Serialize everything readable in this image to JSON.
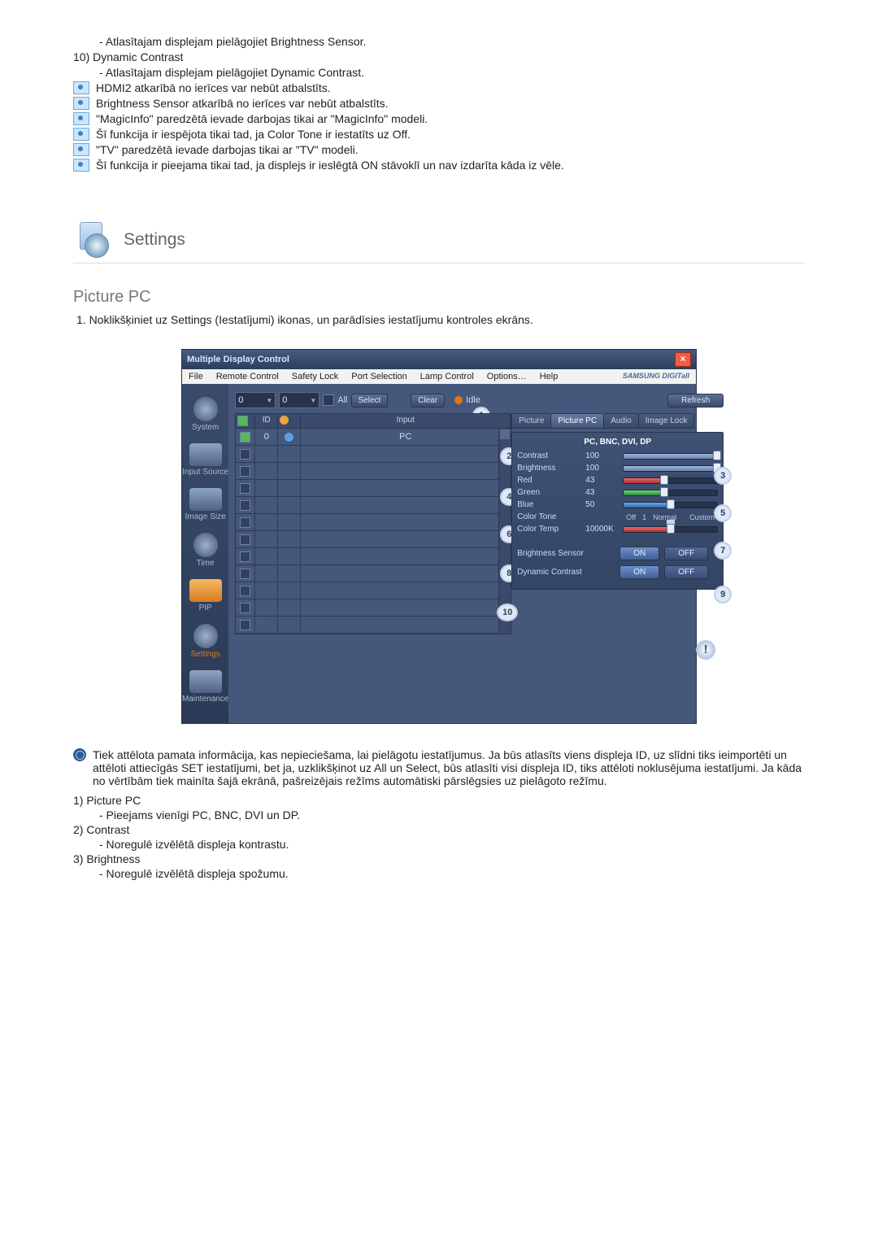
{
  "intro": {
    "line1": "- Atlasītajam displejam pielāgojiet Brightness Sensor.",
    "line2_head": "10) Dynamic Contrast",
    "line2_body": "- Atlasītajam displejam pielāgojiet Dynamic Contrast."
  },
  "notes": [
    "HDMI2 atkarībā no ierīces var nebūt atbalstīts.",
    "Brightness Sensor atkarībā no ierīces var nebūt atbalstīts.",
    "\"MagicInfo\" paredzētā ievade darbojas tikai ar \"MagicInfo\" modeli.",
    "Šī funkcija ir iespējota tikai tad, ja Color Tone ir iestatīts uz Off.",
    "\"TV\" paredzētā ievade darbojas tikai ar \"TV\" modeli.",
    "Šī funkcija ir pieejama tikai tad, ja displejs ir ieslēgtā ON stāvoklī un nav izdarīta kāda iz vēle."
  ],
  "section": {
    "title": "Settings",
    "subtitle": "Picture PC",
    "step1": "1. Noklikšķiniet uz Settings (Iestatījumi) ikonas, un parādīsies iestatījumu kontroles ekrāns."
  },
  "mdc": {
    "title": "Multiple Display Control",
    "close": "×",
    "menu": [
      "File",
      "Remote Control",
      "Safety Lock",
      "Port Selection",
      "Lamp Control",
      "Options…",
      "Help"
    ],
    "brand": "SAMSUNG DIGITall",
    "sidebar": [
      {
        "label": "System"
      },
      {
        "label": "Input Source"
      },
      {
        "label": "Image Size"
      },
      {
        "label": "Time"
      },
      {
        "label": "PIP"
      },
      {
        "label": "Settings",
        "active": true
      },
      {
        "label": "Maintenance"
      }
    ],
    "controls": {
      "num1": "0",
      "num2": "0",
      "all": "All",
      "select": "Select",
      "clear": "Clear",
      "idle": "Idle",
      "refresh": "Refresh"
    },
    "table": {
      "headers": {
        "id": "ID",
        "input": "Input"
      },
      "row0_input": "PC"
    },
    "tabs": [
      "Picture",
      "Picture PC",
      "Audio",
      "Image Lock"
    ],
    "panel": {
      "title": "PC, BNC, DVI, DP",
      "contrast": {
        "label": "Contrast",
        "value": "100"
      },
      "brightness": {
        "label": "Brightness",
        "value": "100"
      },
      "red": {
        "label": "Red",
        "value": "43"
      },
      "green": {
        "label": "Green",
        "value": "43"
      },
      "blue": {
        "label": "Blue",
        "value": "50"
      },
      "colortone": {
        "label": "Color Tone",
        "opts": [
          "Off",
          "1",
          "Normal",
          "",
          "Custom"
        ]
      },
      "colortemp": {
        "label": "Color Temp",
        "value": "10000K"
      },
      "brightSensor": {
        "label": "Brightness Sensor",
        "on": "ON",
        "off": "OFF"
      },
      "dynContrast": {
        "label": "Dynamic Contrast",
        "on": "ON",
        "off": "OFF"
      }
    },
    "callouts": {
      "c1": "1",
      "c2": "2",
      "c3": "3",
      "c4": "4",
      "c5": "5",
      "c6": "6",
      "c7": "7",
      "c8": "8",
      "c9": "9",
      "c10": "10"
    },
    "exclaim": "!"
  },
  "description": {
    "text": "Tiek attēlota pamata informācija, kas nepieciešama, lai pielāgotu iestatījumus. Ja būs atlasīts viens displeja ID, uz slīdni tiks ieimportēti un attēloti attiecīgās SET iestatījumi, bet ja, uzklikšķinot uz All un Select, būs atlasīti visi displeja ID, tiks attēloti noklusējuma iestatījumi. Ja kāda no vērtībām tiek mainīta šajā ekrānā, pašreizējais režīms automātiski pārslēgsies uz pielāgoto režīmu."
  },
  "followup": [
    {
      "head": "1)  Picture PC",
      "body": "- Pieejams vienīgi PC, BNC, DVI un DP."
    },
    {
      "head": "2)  Contrast",
      "body": "- Noregulē izvēlētā displeja kontrastu."
    },
    {
      "head": "3)  Brightness",
      "body": "- Noregulē izvēlētā displeja spožumu."
    }
  ]
}
